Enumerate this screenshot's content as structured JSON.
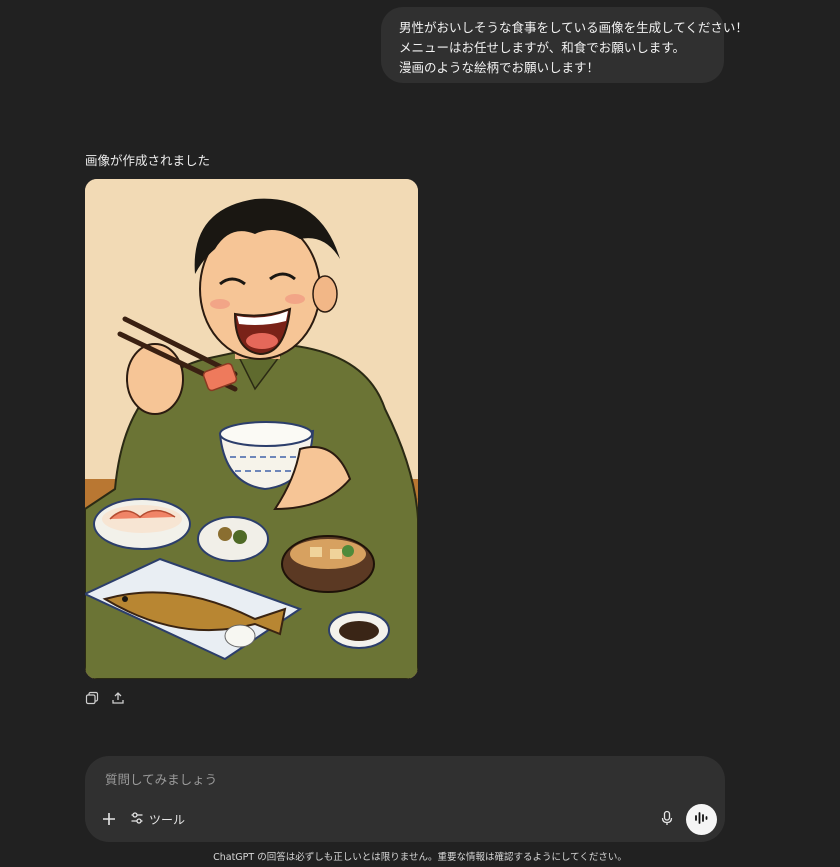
{
  "user_message": {
    "lines": [
      "男性がおいしそうな食事をしている画像を生成してください！",
      "メニューはお任せしますが、和食でお願いします。",
      "漫画のような絵柄でお願いします！"
    ]
  },
  "assistant": {
    "status": "画像が作成されました",
    "image_icons": [
      "copy-icon",
      "share-icon"
    ]
  },
  "composer": {
    "placeholder": "質問してみましょう",
    "tools_label": "ツール"
  },
  "footer": {
    "disclaimer": "ChatGPT の回答は必ずしも正しいとは限りません。重要な情報は確認するようにしてください。"
  },
  "colors": {
    "background": "#212121",
    "bubble": "#303030",
    "composer": "#303030"
  }
}
